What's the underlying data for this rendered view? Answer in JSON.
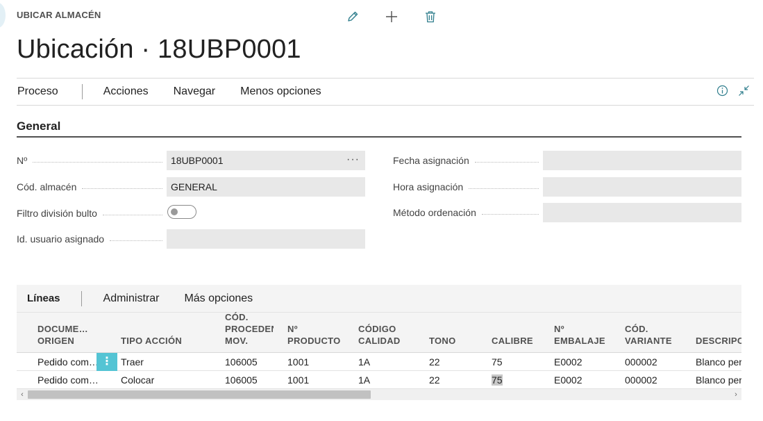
{
  "header": {
    "caption": "UBICAR ALMACÉN",
    "title": "Ubicación · 18UBP0001",
    "top_actions": [
      "edit-icon",
      "add-icon",
      "delete-icon"
    ]
  },
  "action_bar": {
    "items": [
      "Proceso",
      "Acciones",
      "Navegar",
      "Menos opciones"
    ],
    "right_icons": [
      "info-icon",
      "collapse-icon"
    ]
  },
  "general": {
    "title": "General",
    "fields": {
      "no": {
        "label": "Nº",
        "value": "18UBP0001"
      },
      "cod_almacen": {
        "label": "Cód. almacén",
        "value": "GENERAL"
      },
      "filtro_division": {
        "label": "Filtro división bulto",
        "value": "off"
      },
      "id_usuario": {
        "label": "Id. usuario asignado",
        "value": ""
      },
      "fecha_asignacion": {
        "label": "Fecha asignación",
        "value": ""
      },
      "hora_asignacion": {
        "label": "Hora asignación",
        "value": ""
      },
      "metodo_ordenacion": {
        "label": "Método ordenación",
        "value": ""
      }
    }
  },
  "lines": {
    "tabs": [
      "Líneas",
      "Administrar",
      "Más opciones"
    ],
    "columns": [
      [
        "DOCUME…",
        "ORIGEN"
      ],
      [
        "",
        "TIPO ACCIÓN"
      ],
      [
        "CÓD.",
        "PROCEDEN",
        "MOV."
      ],
      [
        "Nº",
        "PRODUCTO"
      ],
      [
        "CÓDIGO",
        "CALIDAD"
      ],
      [
        "",
        "TONO"
      ],
      [
        "",
        "CALIBRE"
      ],
      [
        "Nº",
        "EMBALAJE"
      ],
      [
        "CÓD.",
        "VARIANTE"
      ],
      [
        "",
        "DESCRIPC"
      ]
    ],
    "rows": [
      [
        "Pedido com…",
        "Traer",
        "106005",
        "1001",
        "1A",
        "22",
        "75",
        "E0002",
        "000002",
        "Blanco per"
      ],
      [
        "Pedido com…",
        "Colocar",
        "106005",
        "1001",
        "1A",
        "22",
        "75",
        "E0002",
        "000002",
        "Blanco per"
      ]
    ],
    "row_menu_glyph": "⋮"
  },
  "colors": {
    "accent": "#54c4d4",
    "field_bg": "#e8e8e8",
    "link_icon": "#2e7d8c"
  }
}
